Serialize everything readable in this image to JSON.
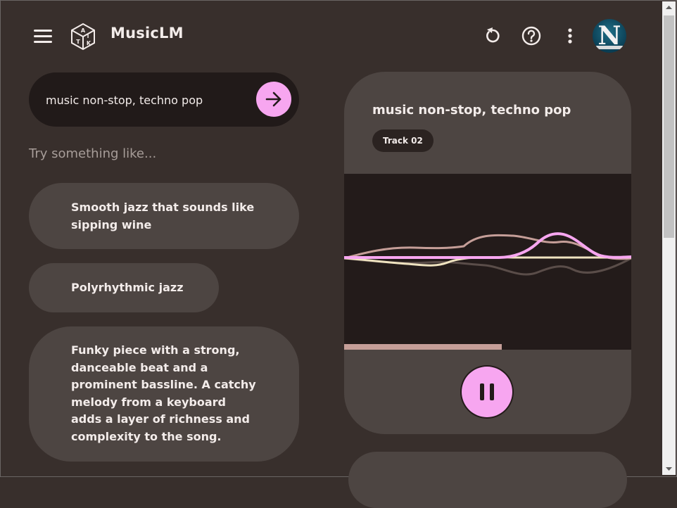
{
  "header": {
    "app_title": "MusicLM",
    "logo_letters": [
      "A",
      "I",
      "T",
      "K"
    ],
    "icons": [
      "menu-icon",
      "logo-cube-icon",
      "refresh-icon",
      "help-icon",
      "more-vert-icon"
    ],
    "avatar_letter": "N"
  },
  "prompt": {
    "value": "music non-stop, techno pop",
    "send_icon": "arrow-right-icon"
  },
  "suggestions": {
    "label": "Try something like...",
    "items": [
      "Smooth jazz that sounds like sipping wine",
      "Polyrhythmic jazz",
      "Funky piece with a strong, danceable beat and a prominent bassline. A catchy melody from a keyboard adds a layer of richness and complexity to the song."
    ]
  },
  "player": {
    "title": "music non-stop, techno pop",
    "track_label": "Track 02",
    "progress": 0.55,
    "control_icon": "pause-icon",
    "colors": {
      "accent": "#f7a6f0",
      "wave_mauve": "#c59e98",
      "wave_cream": "#efe3c0",
      "wave_dark": "#5a4d49"
    }
  }
}
